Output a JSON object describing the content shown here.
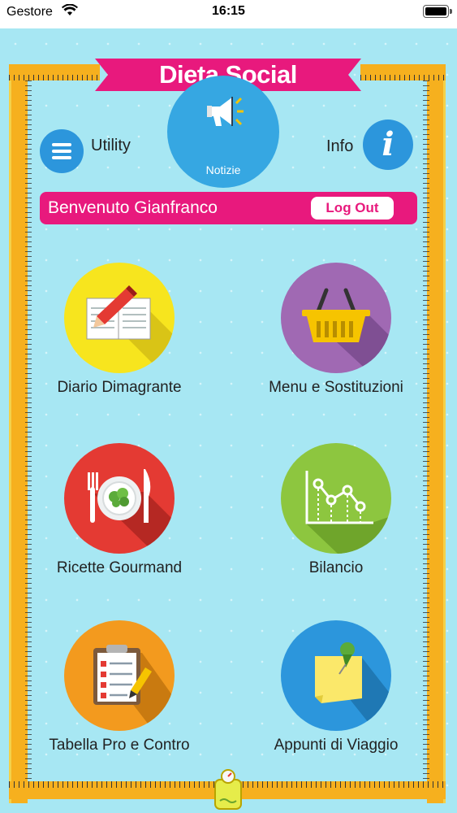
{
  "status_bar": {
    "carrier": "Gestore",
    "time": "16:15"
  },
  "app": {
    "title": "Dieta Social",
    "news_label": "Notizie",
    "utility_label": "Utility",
    "info_label": "Info",
    "info_glyph": "i",
    "welcome_text": "Benvenuto Gianfranco",
    "logout_label": "Log Out"
  },
  "menu": [
    {
      "label": "Diario Dimagrante",
      "icon": "notebook-pencil-icon",
      "color": "#f7e51e"
    },
    {
      "label": "Menu e Sostituzioni",
      "icon": "basket-icon",
      "color": "#a069b3"
    },
    {
      "label": "Ricette Gourmand",
      "icon": "plate-cutlery-icon",
      "color": "#e43a33"
    },
    {
      "label": "Bilancio",
      "icon": "line-chart-icon",
      "color": "#8dc63f"
    },
    {
      "label": "Tabella Pro e Contro",
      "icon": "clipboard-checklist-icon",
      "color": "#f39a1e"
    },
    {
      "label": "Appunti di Viaggio",
      "icon": "sticky-note-pin-icon",
      "color": "#2c96dc"
    }
  ],
  "colors": {
    "background": "#a7e7f3",
    "brand_pink": "#e8197d",
    "tape": "#f6b01e",
    "button_blue": "#2c96dc"
  }
}
